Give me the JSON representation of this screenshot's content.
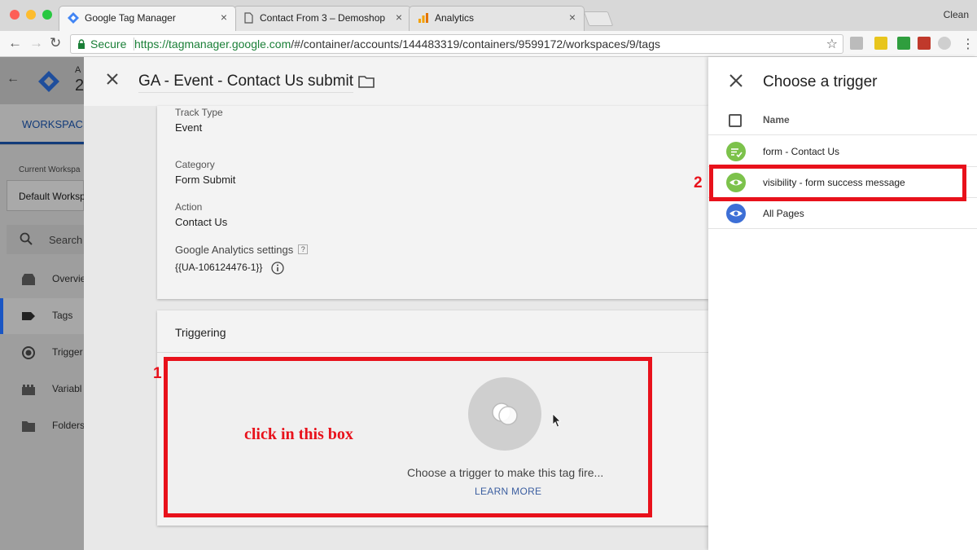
{
  "browser": {
    "tabs": [
      {
        "title": "Google Tag Manager",
        "active": true,
        "icon": "gtm-favicon"
      },
      {
        "title": "Contact From 3 – Demoshop",
        "active": false,
        "icon": "page-icon"
      },
      {
        "title": "Analytics",
        "active": false,
        "icon": "analytics-favicon"
      }
    ],
    "profile_label": "Clean",
    "secure_label": "Secure",
    "url_host": "https://tagmanager.google.com",
    "url_path": "/#/container/accounts/144483319/containers/9599172/workspaces/9/tags"
  },
  "gtm": {
    "account_char": "A",
    "container_char": "2",
    "workspace_tab": "WORKSPACE",
    "current_workspace_label": "Current Workspa",
    "workspace_name": "Default Worksp",
    "search_label": "Search",
    "nav": [
      {
        "label": "Overvie",
        "icon": "overview-icon",
        "selected": false
      },
      {
        "label": "Tags",
        "icon": "tag-icon",
        "selected": true
      },
      {
        "label": "Trigger",
        "icon": "trigger-icon",
        "selected": false
      },
      {
        "label": "Variabl",
        "icon": "variable-icon",
        "selected": false
      },
      {
        "label": "Folders",
        "icon": "folder-icon",
        "selected": false
      }
    ]
  },
  "tag": {
    "title": "GA - Event - Contact Us submit",
    "fields": [
      {
        "label": "Track Type",
        "value": "Event"
      },
      {
        "label": "Category",
        "value": "Form Submit"
      },
      {
        "label": "Action",
        "value": "Contact Us"
      },
      {
        "label": "Google Analytics settings",
        "value": "{{UA-106124476-1}}"
      }
    ],
    "help_mark": "?",
    "triggering": {
      "heading": "Triggering",
      "hint": "Choose a trigger to make this tag fire...",
      "learn_more": "LEARN MORE"
    }
  },
  "annotations": {
    "num1": "1",
    "num2": "2",
    "instruction": "click in this box",
    "color": "#e8111b"
  },
  "trigger_panel": {
    "title": "Choose a trigger",
    "column_name": "Name",
    "items": [
      {
        "label": "form - Contact Us",
        "icon": "form-submit-icon",
        "color": "#7cc24b"
      },
      {
        "label": "visibility - form success message",
        "icon": "eye-icon",
        "color": "#7cc24b"
      },
      {
        "label": "All Pages",
        "icon": "eye-icon",
        "color": "#3d6fd6"
      }
    ]
  }
}
